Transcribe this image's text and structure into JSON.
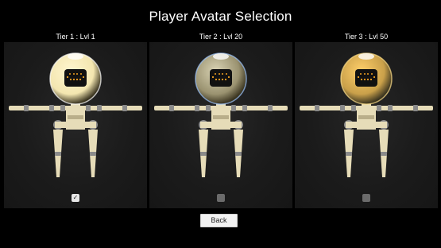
{
  "screen": {
    "title": "Player Avatar Selection"
  },
  "tiers": [
    {
      "label": "Tier 1 : Lvl 1",
      "selected": true,
      "helmet_color": "#f3e6b0",
      "helmet_glow": "#fff6cf",
      "helmet_rim": "#ffffff",
      "face_glyph": "smile"
    },
    {
      "label": "Tier 2 : Lvl 20",
      "selected": false,
      "helmet_color": "#9a9270",
      "helmet_glow": "#d9d3b4",
      "helmet_rim": "#9ec6ff",
      "face_glyph": "smile"
    },
    {
      "label": "Tier 3 : Lvl 50",
      "selected": false,
      "helmet_color": "#c9a04a",
      "helmet_glow": "#ffcf6a",
      "helmet_rim": "#ffe08a",
      "face_glyph": "smile"
    }
  ],
  "checkbox_icon": "checkmark-icon",
  "back_button": {
    "label": "Back"
  },
  "colors": {
    "background": "#000000",
    "panel": "#1b1b1b",
    "limb": "#e6dcb8",
    "joint": "#8a8a8a",
    "visor": "#111111",
    "face": "#f0a020"
  }
}
